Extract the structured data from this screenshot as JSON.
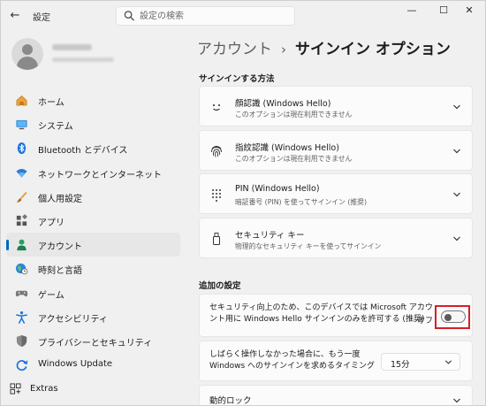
{
  "window": {
    "app_title": "設定",
    "back_glyph": "←",
    "search": {
      "placeholder": "設定の検索",
      "value": ""
    },
    "controls": {
      "minimize": "—",
      "maximize": "☐",
      "close": "✕"
    }
  },
  "sidebar": {
    "items": [
      {
        "label": "ホーム",
        "icon": "home-icon"
      },
      {
        "label": "システム",
        "icon": "system-icon"
      },
      {
        "label": "Bluetooth とデバイス",
        "icon": "bluetooth-icon"
      },
      {
        "label": "ネットワークとインターネット",
        "icon": "wifi-icon"
      },
      {
        "label": "個人用設定",
        "icon": "brush-icon"
      },
      {
        "label": "アプリ",
        "icon": "apps-icon"
      },
      {
        "label": "アカウント",
        "icon": "account-icon",
        "active": true
      },
      {
        "label": "時刻と言語",
        "icon": "globe-clock-icon"
      },
      {
        "label": "ゲーム",
        "icon": "gamepad-icon"
      },
      {
        "label": "アクセシビリティ",
        "icon": "accessibility-icon"
      },
      {
        "label": "プライバシーとセキュリティ",
        "icon": "shield-icon"
      },
      {
        "label": "Windows Update",
        "icon": "update-icon"
      }
    ],
    "extras": {
      "label": "Extras",
      "icon": "extras-icon"
    }
  },
  "main": {
    "breadcrumb": {
      "parent": "アカウント",
      "separator": "›",
      "current": "サインイン オプション"
    },
    "signin_section": {
      "title": "サインインする方法",
      "options": [
        {
          "title": "顔認識 (Windows Hello)",
          "subtitle": "このオプションは現在利用できません",
          "icon": "face-icon"
        },
        {
          "title": "指紋認識 (Windows Hello)",
          "subtitle": "このオプションは現在利用できません",
          "icon": "fingerprint-icon"
        },
        {
          "title": "PIN (Windows Hello)",
          "subtitle": "暗証番号 (PIN) を使ってサインイン (推奨)",
          "icon": "pin-keypad-icon"
        },
        {
          "title": "セキュリティ キー",
          "subtitle": "物理的なセキュリティ キーを使ってサインイン",
          "icon": "usb-key-icon"
        }
      ]
    },
    "additional_section": {
      "title": "追加の設定",
      "hello_only": {
        "line1": "セキュリティ向上のため、このデバイスでは Microsoft アカウ",
        "line2": "ント用に Windows Hello サインインのみを許可する (推奨)",
        "toggle_label": "オフ",
        "toggle_on": false
      },
      "require_signin": {
        "line1": "しばらく操作しなかった場合に、もう一度",
        "line2": "Windows へのサインインを求めるタイミング",
        "selected": "15分"
      },
      "dynamic_lock": {
        "title": "動的ロック"
      }
    }
  },
  "colors": {
    "accent": "#0067c0",
    "highlight": "#d51f26"
  }
}
